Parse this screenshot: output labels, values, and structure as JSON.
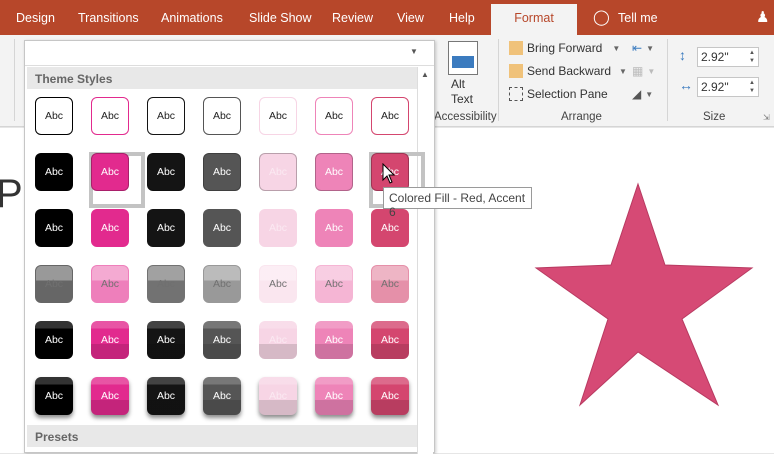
{
  "tabs": [
    "Design",
    "Transitions",
    "Animations",
    "Slide Show",
    "Review",
    "View",
    "Help",
    "Format"
  ],
  "tell_me": "Tell me",
  "ribbon": {
    "alt_text": [
      "Alt",
      "Text"
    ],
    "accessibility": "Accessibility",
    "bring_forward": "Bring Forward",
    "send_backward": "Send Backward",
    "selection_pane": "Selection Pane",
    "arrange": "Arrange",
    "height": "2.92\"",
    "width": "2.92\"",
    "size": "Size"
  },
  "gallery": {
    "theme_styles": "Theme Styles",
    "presets": "Presets",
    "tile_label": "Abc",
    "colors": [
      "#000000",
      "#e22a8e",
      "#141414",
      "#555555",
      "#f7d5e5",
      "#ee84b8",
      "#d4466f"
    ],
    "selected": [
      [
        1,
        1
      ],
      [
        1,
        6
      ]
    ]
  },
  "tooltip": "Colored Fill - Red, Accent 6",
  "slide": {
    "partial_text": "P",
    "star_color": "#d64a75"
  }
}
